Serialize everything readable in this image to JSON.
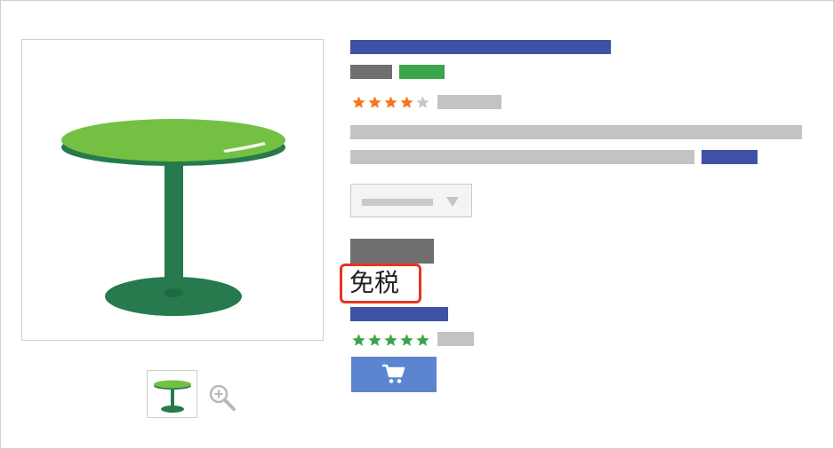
{
  "product": {
    "image_icon": "round-table-icon",
    "thumbnail_icon": "round-table-icon",
    "zoom_icon": "zoom-in-icon",
    "colors": {
      "table_top": "#74c043",
      "table_dark": "#267a4d",
      "title_blue": "#3f51a5",
      "placeholder_gray": "#c3c3c3",
      "rating_orange": "#f07b22",
      "rating_green": "#3aa54a",
      "cart_blue": "#5b86cf",
      "highlight_red": "#e8321e"
    },
    "rating": {
      "stars_filled": 4,
      "stars_total": 5
    },
    "dropdown": {
      "chevron_icon": "chevron-down-icon"
    },
    "tax_label": "免税",
    "seller": {
      "rating": {
        "stars_filled": 5,
        "stars_total": 5
      }
    },
    "cart": {
      "icon": "shopping-cart-icon"
    }
  }
}
